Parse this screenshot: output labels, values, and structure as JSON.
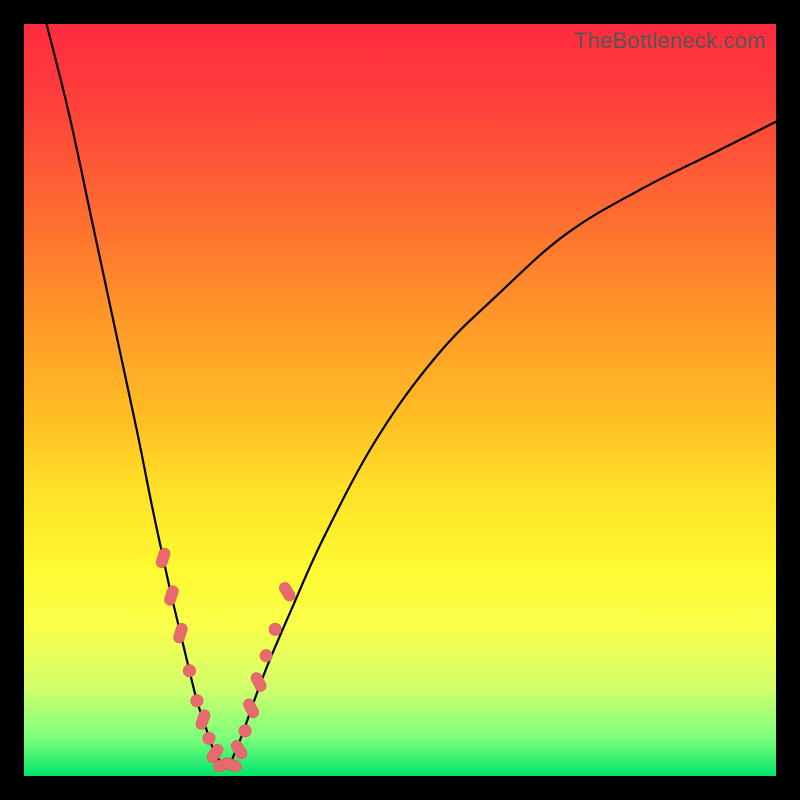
{
  "watermark": "TheBottleneck.com",
  "colors": {
    "frame": "#000000",
    "curve": "#000000",
    "marker": "#e86a6f",
    "gradient_top": "#ff2b3f",
    "gradient_bottom": "#00e46a"
  },
  "chart_data": {
    "type": "line",
    "title": "",
    "xlabel": "",
    "ylabel": "",
    "xlim": [
      0,
      100
    ],
    "ylim": [
      0,
      100
    ],
    "grid": false,
    "legend": false,
    "annotations": [
      "TheBottleneck.com"
    ],
    "series": [
      {
        "name": "left-branch",
        "x": [
          3,
          6,
          9,
          12,
          15,
          17,
          18.5,
          19.6,
          20.8,
          22,
          23,
          24,
          25,
          26,
          27
        ],
        "y": [
          100,
          88,
          74,
          60,
          46,
          36,
          29,
          24,
          19,
          14,
          10,
          7,
          4,
          2,
          1
        ]
      },
      {
        "name": "right-branch",
        "x": [
          27,
          28,
          29.2,
          30.6,
          32.5,
          35.5,
          40,
          47,
          55,
          63,
          72,
          82,
          92,
          100
        ],
        "y": [
          1,
          3,
          6,
          10,
          15,
          22,
          32,
          45,
          56,
          64,
          72,
          78,
          83,
          87
        ]
      }
    ],
    "markers": {
      "name": "data-points",
      "note": "salmon beads/pills clustered near the V minimum on both branches",
      "points": [
        {
          "x": 18.5,
          "y": 29,
          "shape": "pill",
          "angle": -72
        },
        {
          "x": 19.6,
          "y": 24,
          "shape": "pill",
          "angle": -72
        },
        {
          "x": 20.8,
          "y": 19,
          "shape": "pill",
          "angle": -72
        },
        {
          "x": 22.0,
          "y": 14,
          "shape": "bead"
        },
        {
          "x": 23.0,
          "y": 10,
          "shape": "bead"
        },
        {
          "x": 23.8,
          "y": 7.5,
          "shape": "pill",
          "angle": -70
        },
        {
          "x": 24.6,
          "y": 5.0,
          "shape": "bead"
        },
        {
          "x": 25.4,
          "y": 3.0,
          "shape": "pill",
          "angle": -55
        },
        {
          "x": 26.5,
          "y": 1.5,
          "shape": "pill",
          "angle": -20
        },
        {
          "x": 27.6,
          "y": 1.5,
          "shape": "pill",
          "angle": 20
        },
        {
          "x": 28.6,
          "y": 3.5,
          "shape": "pill",
          "angle": 58
        },
        {
          "x": 29.4,
          "y": 6.0,
          "shape": "bead"
        },
        {
          "x": 30.2,
          "y": 9.0,
          "shape": "pill",
          "angle": 62
        },
        {
          "x": 31.2,
          "y": 12.5,
          "shape": "pill",
          "angle": 62
        },
        {
          "x": 32.2,
          "y": 16.0,
          "shape": "bead"
        },
        {
          "x": 33.4,
          "y": 19.5,
          "shape": "bead"
        },
        {
          "x": 35.0,
          "y": 24.5,
          "shape": "pill",
          "angle": 58
        }
      ]
    }
  }
}
